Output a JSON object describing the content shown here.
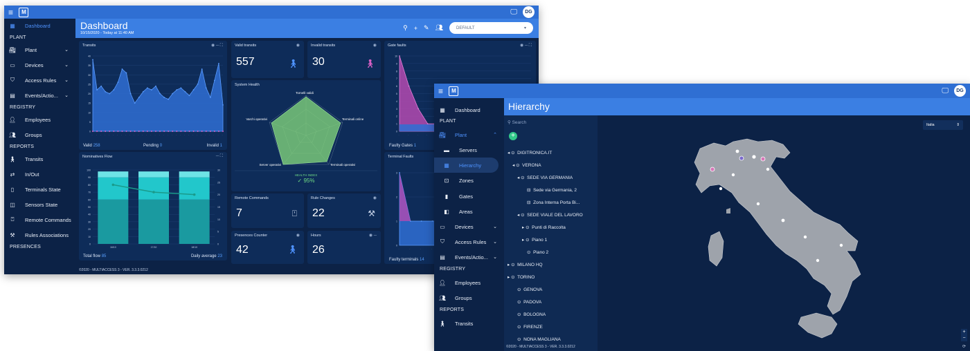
{
  "dash": {
    "title": "Dashboard",
    "subtitle": "10/15/2020 - Today at 11:40 AM",
    "preset": "DEFAULT",
    "avatar": "DG",
    "footer": "©2020 - MULTIACCESS 3 - VER. 3.3.3.0212",
    "sidebar": {
      "dashboard": "Dashboard",
      "plant": "PLANT",
      "plant_item": "Plant",
      "devices": "Devices",
      "access_rules": "Access Rules",
      "events": "Events/Actio...",
      "registry": "REGISTRY",
      "employees": "Employees",
      "groups": "Groups",
      "reports": "REPORTS",
      "transits": "Transits",
      "inout": "In/Out",
      "terminals_state": "Terminals State",
      "sensors_state": "Sensors State",
      "remote_commands": "Remote Commands",
      "rules_associations": "Rules Associations",
      "presences": "PRESENCES"
    },
    "transits": {
      "title": "Transits",
      "valid": "Valid",
      "valid_n": "258",
      "pending": "Pending",
      "pending_n": "0",
      "invalid": "Invalid",
      "invalid_n": "1"
    },
    "valid_transits": {
      "title": "Valid transits",
      "value": "557"
    },
    "invalid_transits": {
      "title": "Invalid transits",
      "value": "30"
    },
    "gate_faults": {
      "title": "Gate faults",
      "foot": "Faulty Gates",
      "foot_n": "1"
    },
    "system_health": {
      "title": "System Health",
      "axes": [
        "Tornelli validi",
        "Terminali online",
        "Terminali operativi",
        "Server operativi",
        "Varchi operativi"
      ],
      "index_label": "HEALTH INDEX",
      "index_value": "95%"
    },
    "nominatives": {
      "title": "Nominatives Flow",
      "total": "Total flow",
      "total_n": "85",
      "avg": "Daily average",
      "avg_n": "23",
      "days": [
        "16/10",
        "17/10",
        "18/10"
      ]
    },
    "remote_commands": {
      "title": "Remote Commands",
      "value": "7"
    },
    "rule_changes": {
      "title": "Rule Changes",
      "value": "22"
    },
    "presences_counter": {
      "title": "Presences Counter",
      "value": "42"
    },
    "hours": {
      "title": "Hours",
      "value": "26"
    },
    "terminal_faults": {
      "title": "Terminal Faults",
      "foot": "Faulty terminals",
      "foot_n": "14"
    }
  },
  "chart_data": [
    {
      "type": "area",
      "title": "Transits",
      "ylim": [
        0,
        40
      ],
      "y_ticks": [
        0,
        5,
        10,
        15,
        20,
        25,
        30,
        35,
        40
      ],
      "series": [
        {
          "name": "Valid",
          "values": [
            38,
            22,
            24,
            21,
            20,
            22,
            26,
            33,
            31,
            20,
            15,
            18,
            21,
            23,
            22,
            24,
            20,
            18,
            17,
            20,
            22,
            23,
            21,
            19,
            22,
            25,
            33,
            23,
            18,
            27,
            36,
            14
          ]
        },
        {
          "name": "Invalid",
          "values": [
            0,
            0,
            0,
            0,
            0,
            0,
            0,
            0,
            0,
            0,
            0,
            0,
            0,
            0,
            0,
            0,
            0,
            0,
            0,
            0,
            0,
            0,
            0,
            0,
            0,
            0,
            0,
            0,
            0,
            0,
            0,
            0
          ]
        }
      ]
    },
    {
      "type": "bar",
      "title": "Nominatives Flow",
      "categories": [
        "16/10",
        "17/10",
        "18/10"
      ],
      "ylim": [
        0,
        100
      ],
      "y_ticks": [
        0,
        10,
        20,
        30,
        40,
        50,
        60,
        70,
        80,
        90,
        100
      ],
      "y2_ticks": [
        0,
        5,
        10,
        15,
        20,
        25,
        30
      ],
      "series": [
        {
          "name": "",
          "values": [
            60,
            60,
            60
          ]
        },
        {
          "name": "",
          "values": [
            30,
            30,
            30
          ]
        },
        {
          "name": "",
          "values": [
            8,
            8,
            8
          ]
        }
      ],
      "line": [
        24,
        21,
        20
      ]
    },
    {
      "type": "area",
      "title": "Gate faults",
      "ylim": [
        0,
        10
      ],
      "y_ticks": [
        0,
        1,
        2,
        3,
        4,
        5,
        6,
        7,
        8,
        9,
        10
      ],
      "values": [
        10,
        6,
        3,
        1,
        1,
        1,
        1,
        1,
        1,
        1,
        1,
        1,
        1,
        1,
        1
      ]
    },
    {
      "type": "area",
      "title": "Terminal Faults",
      "ylim": [
        0,
        3
      ],
      "y_ticks": [
        0,
        1,
        2,
        3
      ],
      "values": [
        3,
        1,
        1,
        1,
        1,
        1,
        1,
        1,
        1,
        1,
        1,
        1,
        1
      ]
    }
  ],
  "hier": {
    "title": "Hierarchy",
    "avatar": "DG",
    "search_placeholder": "Search",
    "map_select": "Italia",
    "footer": "©2020 - MULTIACCESS 3 - VER. 3.3.3.0212",
    "sidebar": {
      "dashboard": "Dashboard",
      "plant": "PLANT",
      "plant_item": "Plant",
      "servers": "Servers",
      "hierarchy": "Hierarchy",
      "zones": "Zones",
      "gates": "Gates",
      "areas": "Areas",
      "devices": "Devices",
      "access_rules": "Access Rules",
      "events": "Events/Actio...",
      "registry": "REGISTRY",
      "employees": "Employees",
      "groups": "Groups",
      "reports": "REPORTS",
      "transits": "Transits"
    },
    "tree": [
      "DIGITRONICA.IT",
      "VERONA",
      "SEDE VIA GERMANIA",
      "Sede via Germania, 2",
      "Zona Interna Porta Bi...",
      "SEDE VIALE DEL LAVORO",
      "Punti di Raccolta",
      "Piano 1",
      "Piano 2",
      "MILANO HQ",
      "TORINO",
      "GENOVA",
      "PADOVA",
      "BOLOGNA",
      "FIRENZE",
      "NONA MAGLIANA"
    ]
  }
}
